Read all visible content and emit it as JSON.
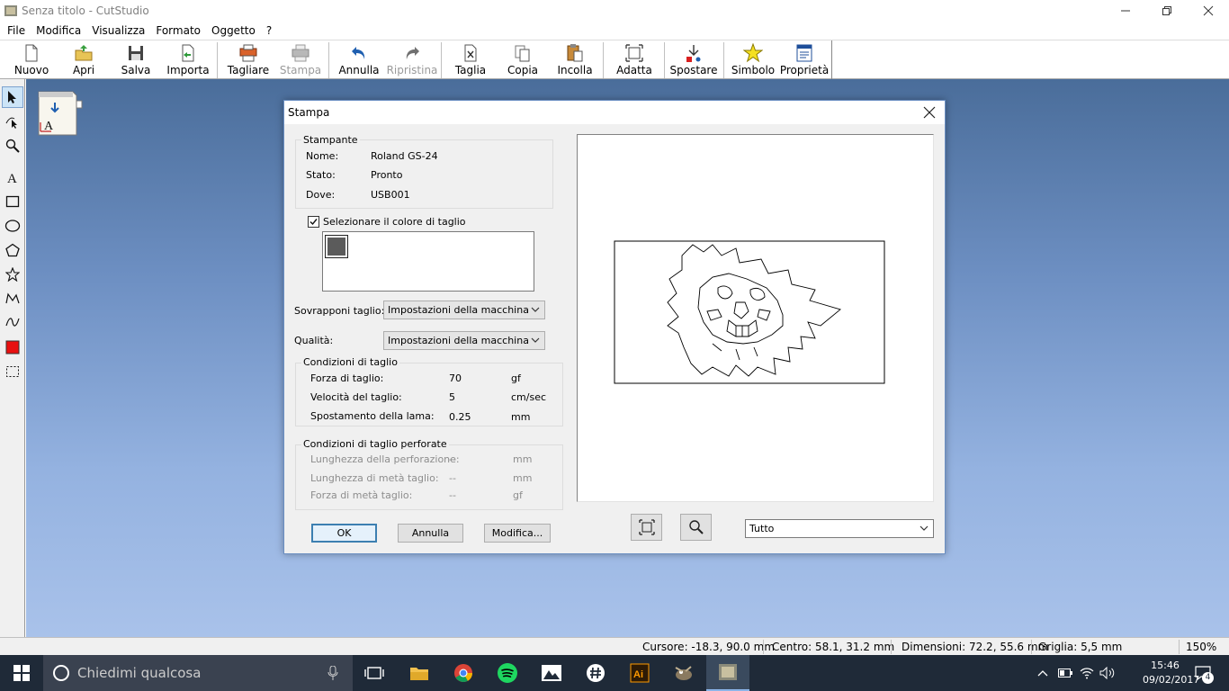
{
  "window": {
    "title": "Senza titolo - CutStudio"
  },
  "menu": {
    "items": [
      "File",
      "Modifica",
      "Visualizza",
      "Formato",
      "Oggetto",
      "?"
    ]
  },
  "toolbar": {
    "buttons": [
      {
        "label": "Nuovo",
        "icon": "new-document-icon",
        "enabled": true
      },
      {
        "label": "Apri",
        "icon": "open-folder-icon",
        "enabled": true
      },
      {
        "label": "Salva",
        "icon": "save-disk-icon",
        "enabled": true
      },
      {
        "label": "Importa",
        "icon": "import-icon",
        "enabled": true
      },
      {
        "label": "Tagliare",
        "icon": "cutter-icon",
        "enabled": true
      },
      {
        "label": "Stampa",
        "icon": "printer-icon",
        "enabled": false
      },
      {
        "label": "Annulla",
        "icon": "undo-icon",
        "enabled": true
      },
      {
        "label": "Ripristina",
        "icon": "redo-icon",
        "enabled": false
      },
      {
        "label": "Taglia",
        "icon": "cut-icon",
        "enabled": true
      },
      {
        "label": "Copia",
        "icon": "copy-icon",
        "enabled": true
      },
      {
        "label": "Incolla",
        "icon": "paste-icon",
        "enabled": true
      },
      {
        "label": "Adatta",
        "icon": "fit-icon",
        "enabled": true
      },
      {
        "label": "Spostare",
        "icon": "move-origin-icon",
        "enabled": true
      },
      {
        "label": "Simbolo",
        "icon": "star-symbol-icon",
        "enabled": true
      },
      {
        "label": "Proprietà",
        "icon": "properties-icon",
        "enabled": true
      }
    ]
  },
  "left_tools": [
    "select-arrow-icon",
    "node-edit-icon",
    "zoom-icon",
    "text-tool-icon",
    "rectangle-tool-icon",
    "ellipse-tool-icon",
    "polygon-tool-icon",
    "star-tool-icon",
    "polyline-tool-icon",
    "curve-tool-icon",
    "fill-color-icon",
    "selection-frame-icon"
  ],
  "dialog": {
    "title": "Stampa",
    "printer": {
      "group_title": "Stampante",
      "name_label": "Nome:",
      "name_value": "Roland GS-24",
      "status_label": "Stato:",
      "status_value": "Pronto",
      "where_label": "Dove:",
      "where_value": "USB001"
    },
    "select_color": {
      "label": "Selezionare il colore di taglio",
      "checked": true,
      "swatch_color": "#5b5b5b"
    },
    "overlap": {
      "label": "Sovrapponi taglio:",
      "value": "Impostazioni della macchina"
    },
    "quality": {
      "label": "Qualità:",
      "value": "Impostazioni della macchina"
    },
    "cutting_conditions": {
      "group_title": "Condizioni di taglio",
      "rows": [
        {
          "label": "Forza di taglio:",
          "value": "70",
          "unit": "gf"
        },
        {
          "label": "Velocità del taglio:",
          "value": "5",
          "unit": "cm/sec"
        },
        {
          "label": "Spostamento della lama:",
          "value": "0.25",
          "unit": "mm"
        }
      ]
    },
    "perforated_conditions": {
      "group_title": "Condizioni di taglio perforate",
      "rows": [
        {
          "label": "Lunghezza della perforazione:",
          "value": "--",
          "unit": "mm"
        },
        {
          "label": "Lunghezza di metà taglio:",
          "value": "--",
          "unit": "mm"
        },
        {
          "label": "Forza di metà taglio:",
          "value": "--",
          "unit": "gf"
        }
      ]
    },
    "buttons": {
      "ok": "OK",
      "cancel": "Annulla",
      "modify": "Modifica..."
    },
    "preview_range": {
      "value": "Tutto"
    }
  },
  "statusbar": {
    "cursor": "Cursore: -18.3, 90.0 mm",
    "center": "Centro: 58.1, 31.2 mm",
    "dimensions": "Dimensioni: 72.2, 55.6 mm",
    "grid": "Griglia: 5,5 mm",
    "zoom": "150%"
  },
  "taskbar": {
    "search_placeholder": "Chiedimi qualcosa",
    "time": "15:46",
    "date": "09/02/2017",
    "notification_count": "4"
  }
}
